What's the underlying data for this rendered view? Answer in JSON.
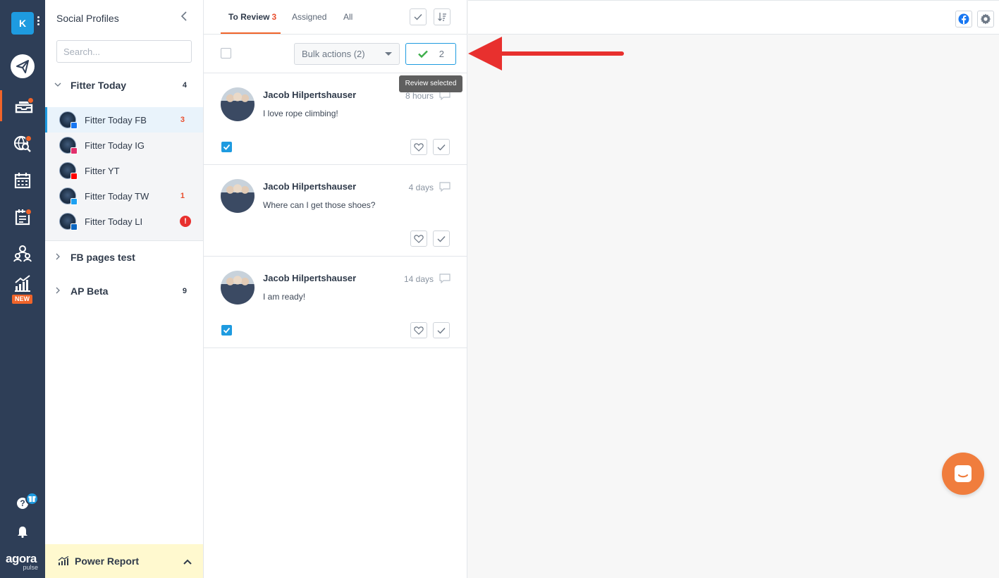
{
  "rail": {
    "workspace_initial": "K",
    "new_label": "NEW",
    "logo_main": "agora",
    "logo_sub": "pulse"
  },
  "profiles_panel": {
    "title": "Social Profiles",
    "search_placeholder": "Search...",
    "groups": [
      {
        "name": "Fitter Today",
        "count": "4",
        "expanded": true
      },
      {
        "name": "FB pages test",
        "count": "",
        "expanded": false
      },
      {
        "name": "AP Beta",
        "count": "9",
        "expanded": false
      }
    ],
    "profiles": [
      {
        "name": "Fitter Today FB",
        "network": "facebook",
        "count": "3",
        "network_color": "#1877f2"
      },
      {
        "name": "Fitter Today IG",
        "network": "instagram",
        "count": "",
        "network_color": "#e1306c"
      },
      {
        "name": "Fitter YT",
        "network": "youtube",
        "count": "",
        "network_color": "#ff0000"
      },
      {
        "name": "Fitter Today TW",
        "network": "twitter",
        "count": "1",
        "network_color": "#1da1f2"
      },
      {
        "name": "Fitter Today LI",
        "network": "linkedin",
        "count": "",
        "network_color": "#0a66c2",
        "alert": "!"
      }
    ],
    "power_report": "Power Report"
  },
  "inbox": {
    "tabs": [
      {
        "label": "To Review",
        "count": "3",
        "active": true
      },
      {
        "label": "Assigned",
        "count": "",
        "active": false
      },
      {
        "label": "All",
        "count": "",
        "active": false
      }
    ],
    "bulk_actions_label": "Bulk actions (2)",
    "review_selected_count": "2",
    "tooltip": "Review selected",
    "messages": [
      {
        "author": "Jacob Hilpertshauser",
        "text": "I love rope climbing!",
        "time": "8 hours",
        "checked": true
      },
      {
        "author": "Jacob Hilpertshauser",
        "text": "Where can I get those shoes?",
        "time": "4 days",
        "checked": false
      },
      {
        "author": "Jacob Hilpertshauser",
        "text": "I am ready!",
        "time": "14 days",
        "checked": true
      }
    ]
  },
  "colors": {
    "accent": "#f0642a",
    "primary": "#1e9be0",
    "rail_bg": "#2e3e57",
    "arrow": "#e8302e"
  }
}
